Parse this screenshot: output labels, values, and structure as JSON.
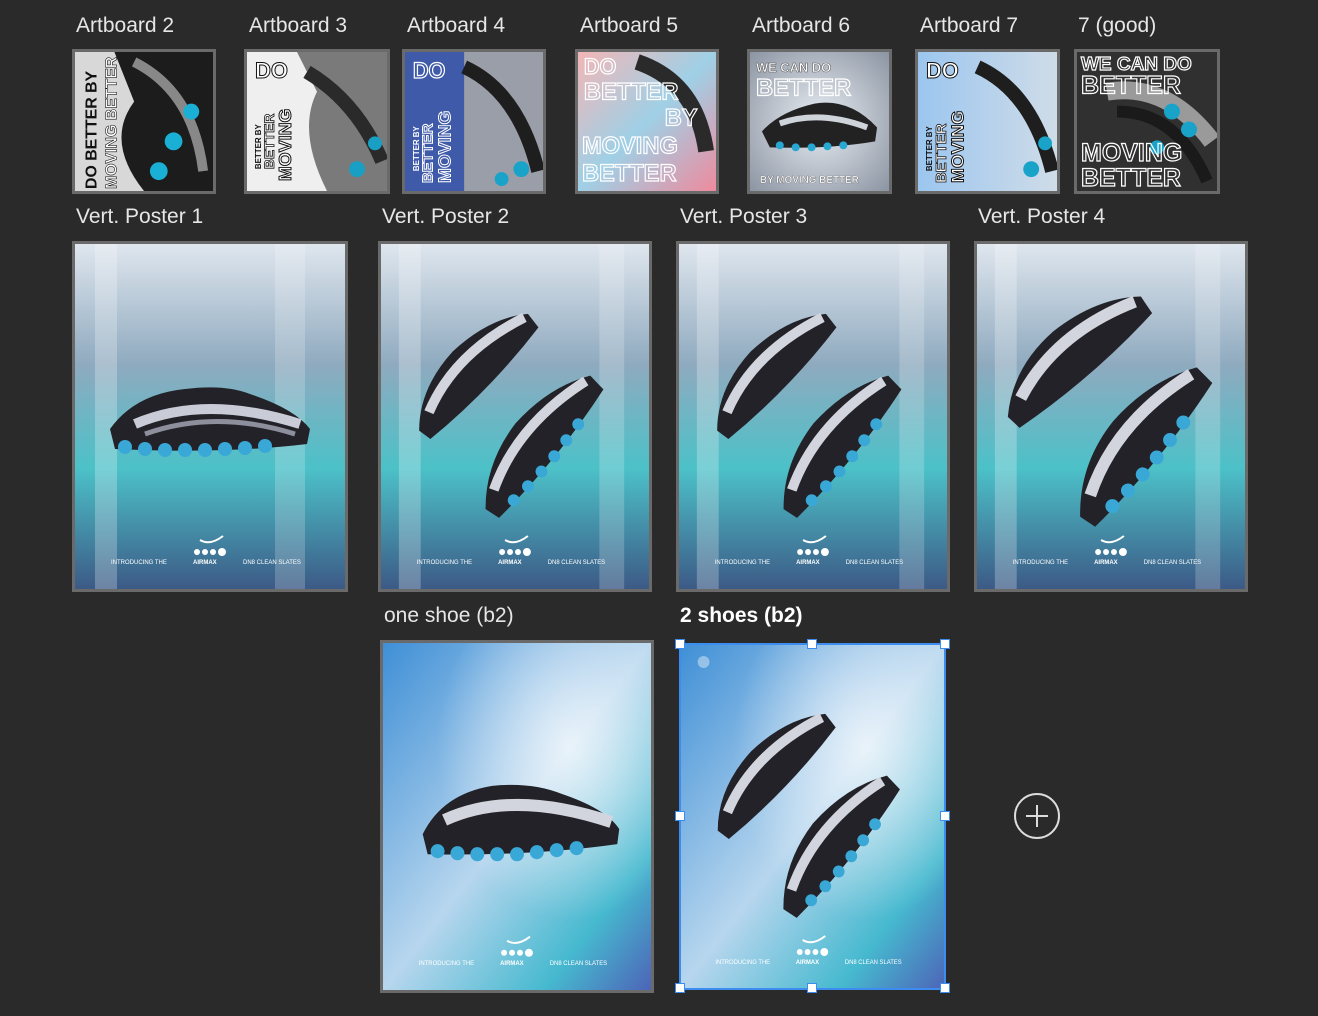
{
  "canvas": {
    "artboards_row1": [
      {
        "title": "Artboard 2",
        "lines": [
          "DO BETTER BY",
          "MOVING BETTER"
        ],
        "style": "dark-vertical"
      },
      {
        "title": "Artboard 3",
        "lines": [
          "DO",
          "BETTER BY",
          "MOVING",
          "BETTER"
        ],
        "style": "light-vertical"
      },
      {
        "title": "Artboard 4",
        "lines": [
          "DO",
          "BETTER BY",
          "MOVING",
          "BETTER"
        ],
        "style": "blue-vertical"
      },
      {
        "title": "Artboard 5",
        "lines": [
          "DO",
          "BETTER",
          "BY",
          "MOVING",
          "BETTER"
        ],
        "style": "pink-stack"
      },
      {
        "title": "Artboard 6",
        "lines": [
          "WE CAN DO",
          "BETTER",
          "BY MOVING BETTER"
        ],
        "style": "cloud-shoe"
      },
      {
        "title": "Artboard 7",
        "lines": [
          "DO",
          "BETTER BY",
          "MOVING",
          "BETTER"
        ],
        "style": "blue-vertical"
      },
      {
        "title": "7 (good)",
        "lines": [
          "WE CAN DO",
          "BETTER",
          "MOVING",
          "BETTER"
        ],
        "style": "dark-stack"
      }
    ],
    "posters_row2": [
      {
        "title": "Vert. Poster 1",
        "shoes": 1
      },
      {
        "title": "Vert. Poster 2",
        "shoes": 2
      },
      {
        "title": "Vert. Poster 3",
        "shoes": 2
      },
      {
        "title": "Vert. Poster 4",
        "shoes": 2
      }
    ],
    "posters_row3": [
      {
        "title": "one shoe (b2)",
        "shoes": 1,
        "selected": false
      },
      {
        "title": "2 shoes (b2)",
        "shoes": 2,
        "selected": true
      }
    ],
    "poster_footer": {
      "left": "INTRODUCING THE",
      "center": "AIRMAX",
      "right": "DN8 CLEAN SLATES"
    },
    "add_artboard_icon": "plus-circle-icon",
    "selection_color": "#3d8cf0"
  }
}
